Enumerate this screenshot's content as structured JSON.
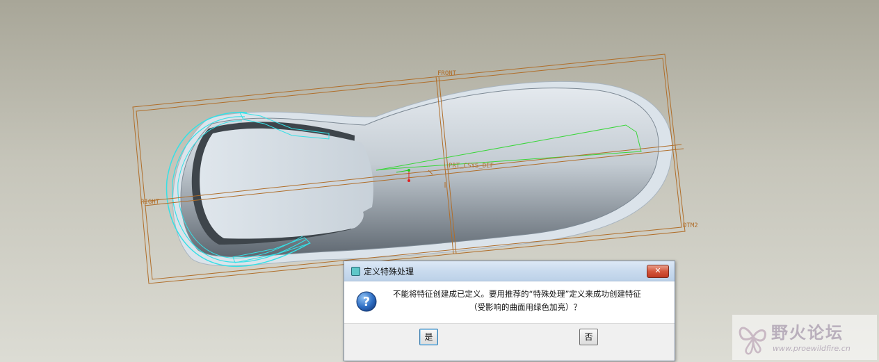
{
  "viewport": {
    "datum_front": "FRONT",
    "datum_right": "RIGHT",
    "datum_dtm2": "DTM2",
    "csys_label": "PRT_CSYS_DEF"
  },
  "dialog": {
    "title": "定义特殊处理",
    "close_label": "✕",
    "message_line1": "不能将特征创建成已定义。要用推荐的“特殊处理”定义来成功创建特征",
    "message_line2": "（受影响的曲面用绿色加亮）？",
    "yes_label": "是",
    "no_label": "否"
  },
  "watermark": {
    "title": "野火论坛",
    "url": "www.proewildfire.cn"
  },
  "colors": {
    "datum": "#b06e2a",
    "highlight_cyan": "#35e0e6",
    "highlight_green": "#3ad63a",
    "surface": "#c4ccd3"
  }
}
